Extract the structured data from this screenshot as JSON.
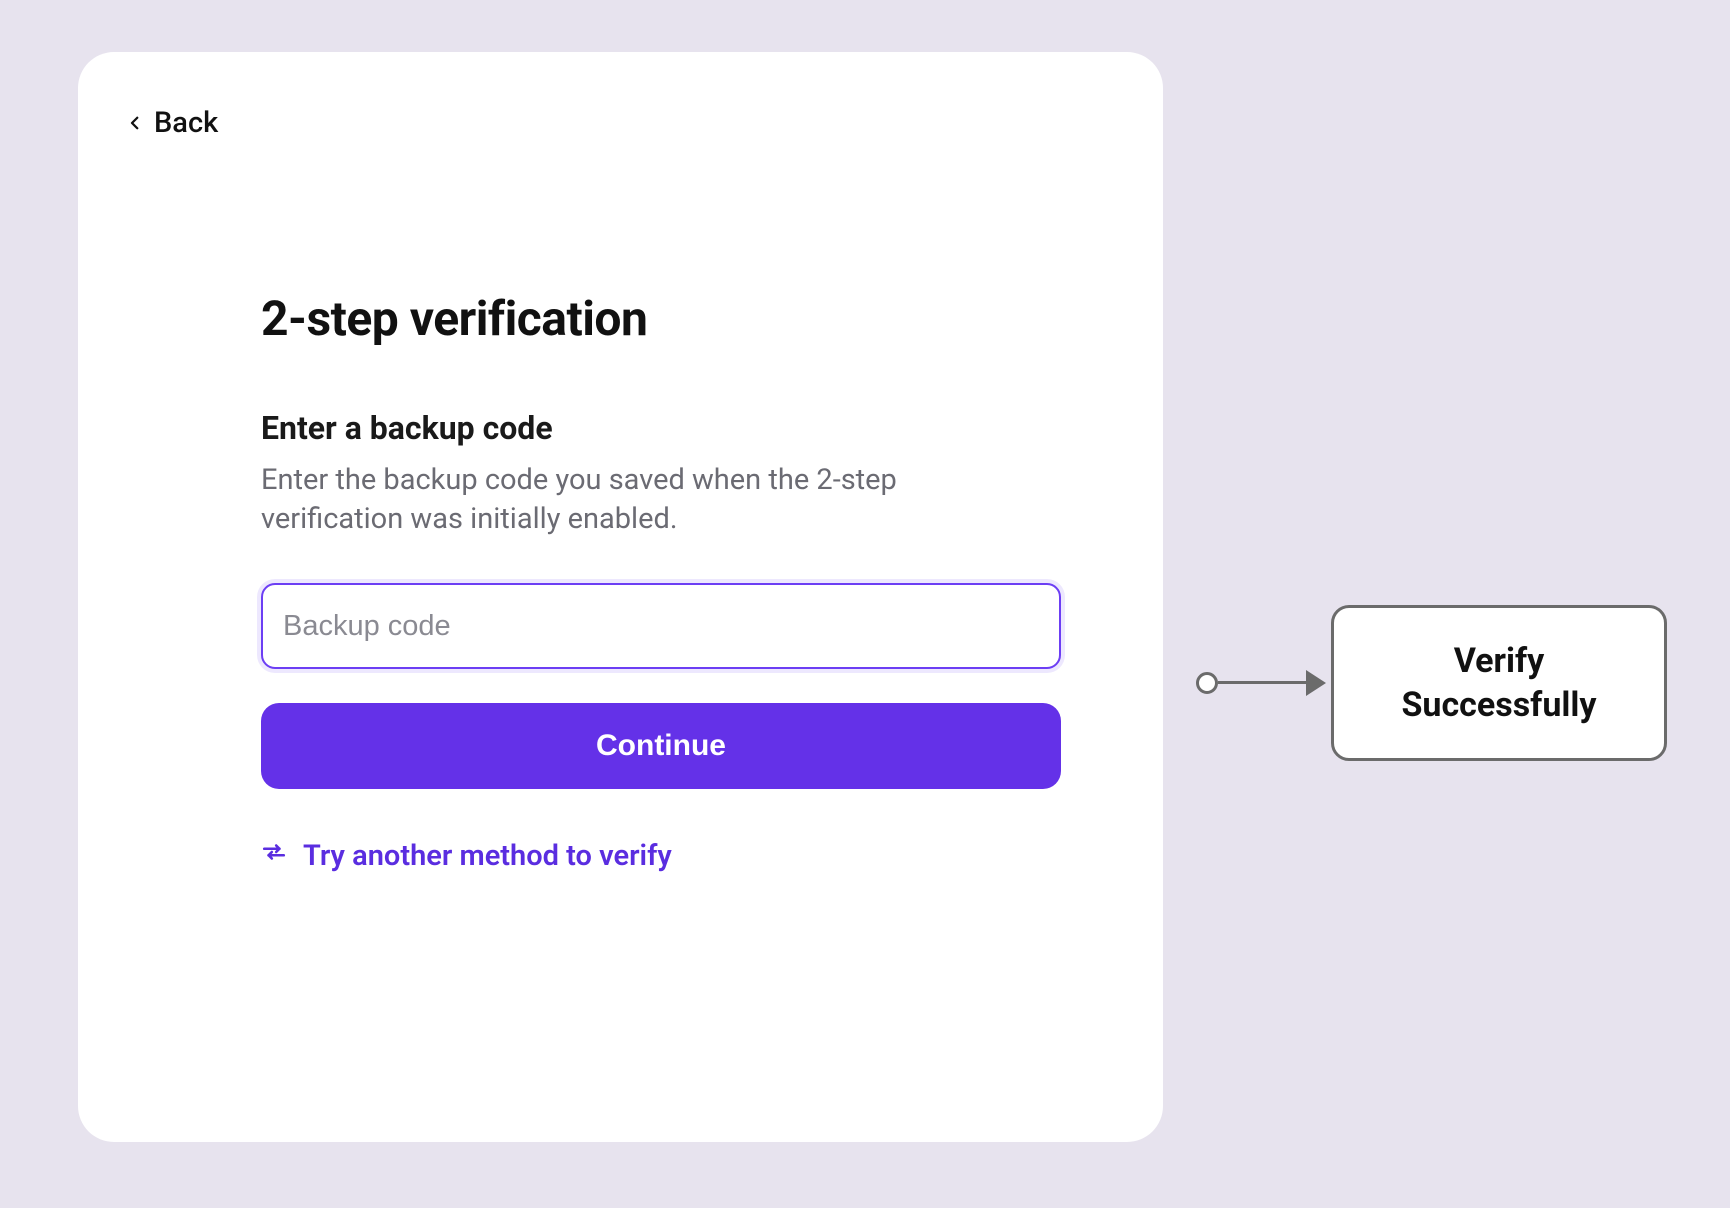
{
  "nav": {
    "back_label": "Back"
  },
  "card": {
    "title": "2-step verification",
    "subtitle": "Enter a backup code",
    "description": "Enter the backup code you saved when the 2-step verification was initially enabled.",
    "input_placeholder": "Backup code",
    "input_value": "",
    "continue_label": "Continue",
    "alt_method_label": "Try another method to verify"
  },
  "flow": {
    "next_node_label": "Verify\nSuccessfully"
  },
  "colors": {
    "accent": "#6431E8",
    "background": "#E7E3EE"
  }
}
